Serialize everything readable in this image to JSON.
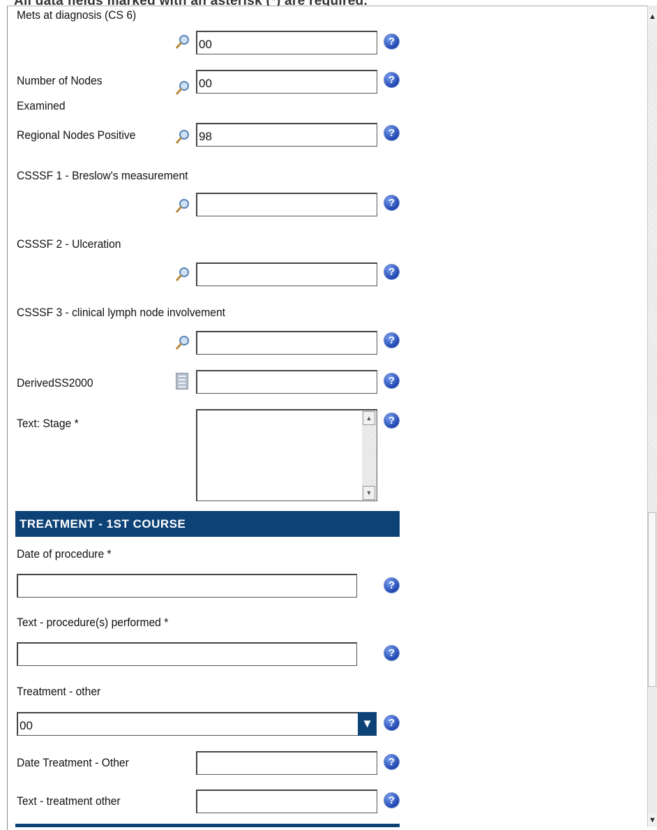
{
  "page": {
    "top_note": "All data fields marked with an asterisk (*) are required."
  },
  "icons": {
    "lookup": "magnifier-icon",
    "help": "help-icon",
    "calculator": "calculator-icon",
    "dropdown": "dropdown-arrow-icon"
  },
  "colors": {
    "section_header_bg": "#0d4277",
    "help_icon": "#1f45b0"
  },
  "fields": {
    "mets": {
      "label": "Mets at diagnosis (CS 6)",
      "value": "00"
    },
    "nodes_examined": {
      "label_line1": "Number of Nodes",
      "label_line2": "Examined",
      "value": "00"
    },
    "nodes_positive": {
      "label": "Regional Nodes Positive",
      "value": "98"
    },
    "csssf1": {
      "label": "CSSSF 1 - Breslow's measurement",
      "value": ""
    },
    "csssf2": {
      "label": "CSSSF 2 - Ulceration",
      "value": ""
    },
    "csssf3": {
      "label": "CSSSF 3 - clinical lymph node involvement",
      "value": ""
    },
    "derived": {
      "label": "DerivedSS2000",
      "value": ""
    },
    "text_stage": {
      "label": "Text: Stage *",
      "value": ""
    }
  },
  "treatment": {
    "section_title": "TREATMENT - 1ST COURSE",
    "date_procedure": {
      "label": "Date of procedure *",
      "value": ""
    },
    "text_procedure": {
      "label": "Text - procedure(s) performed *",
      "value": ""
    },
    "treatment_other": {
      "label": "Treatment - other",
      "selected": "00"
    },
    "date_treatment_other": {
      "label": "Date Treatment - Other",
      "value": ""
    },
    "text_treatment_other": {
      "label": "Text - treatment other",
      "value": ""
    }
  },
  "help_glyph": "?"
}
